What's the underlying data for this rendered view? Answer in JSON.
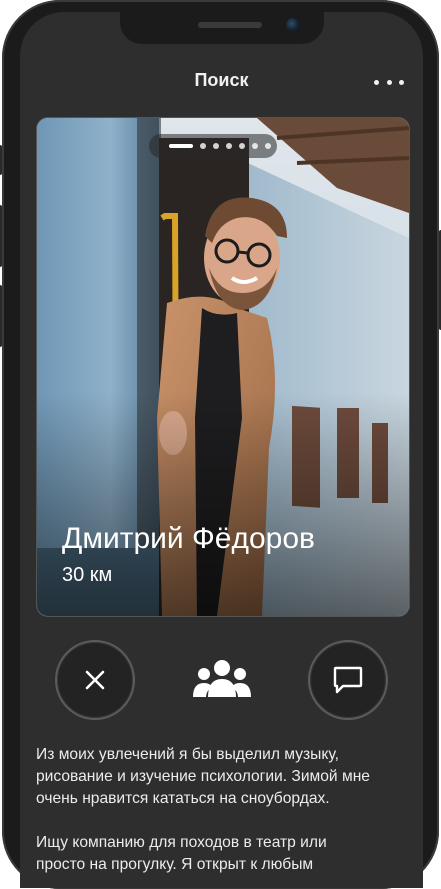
{
  "header": {
    "title": "Поиск",
    "more_icon": "more-dots-icon"
  },
  "profile": {
    "name": "Дмитрий Фёдоров",
    "distance": "30 км",
    "photo_count": 7,
    "active_photo": 1
  },
  "actions": {
    "dislike_icon": "close-icon",
    "group_icon": "people-group-icon",
    "message_icon": "chat-bubble-icon"
  },
  "bio": {
    "paragraph_1": "Из моих увлечений я бы выделил музыку,\nрисование и изучение психологии. Зимой мне\nочень нравится кататься на сноубордах.",
    "paragraph_2": "Ищу компанию для походов в театр или\nпросто на прогулку. Я открыт к любым"
  },
  "colors": {
    "background": "#2e2e2e",
    "text": "#ececec",
    "accent": "#ffffff"
  }
}
